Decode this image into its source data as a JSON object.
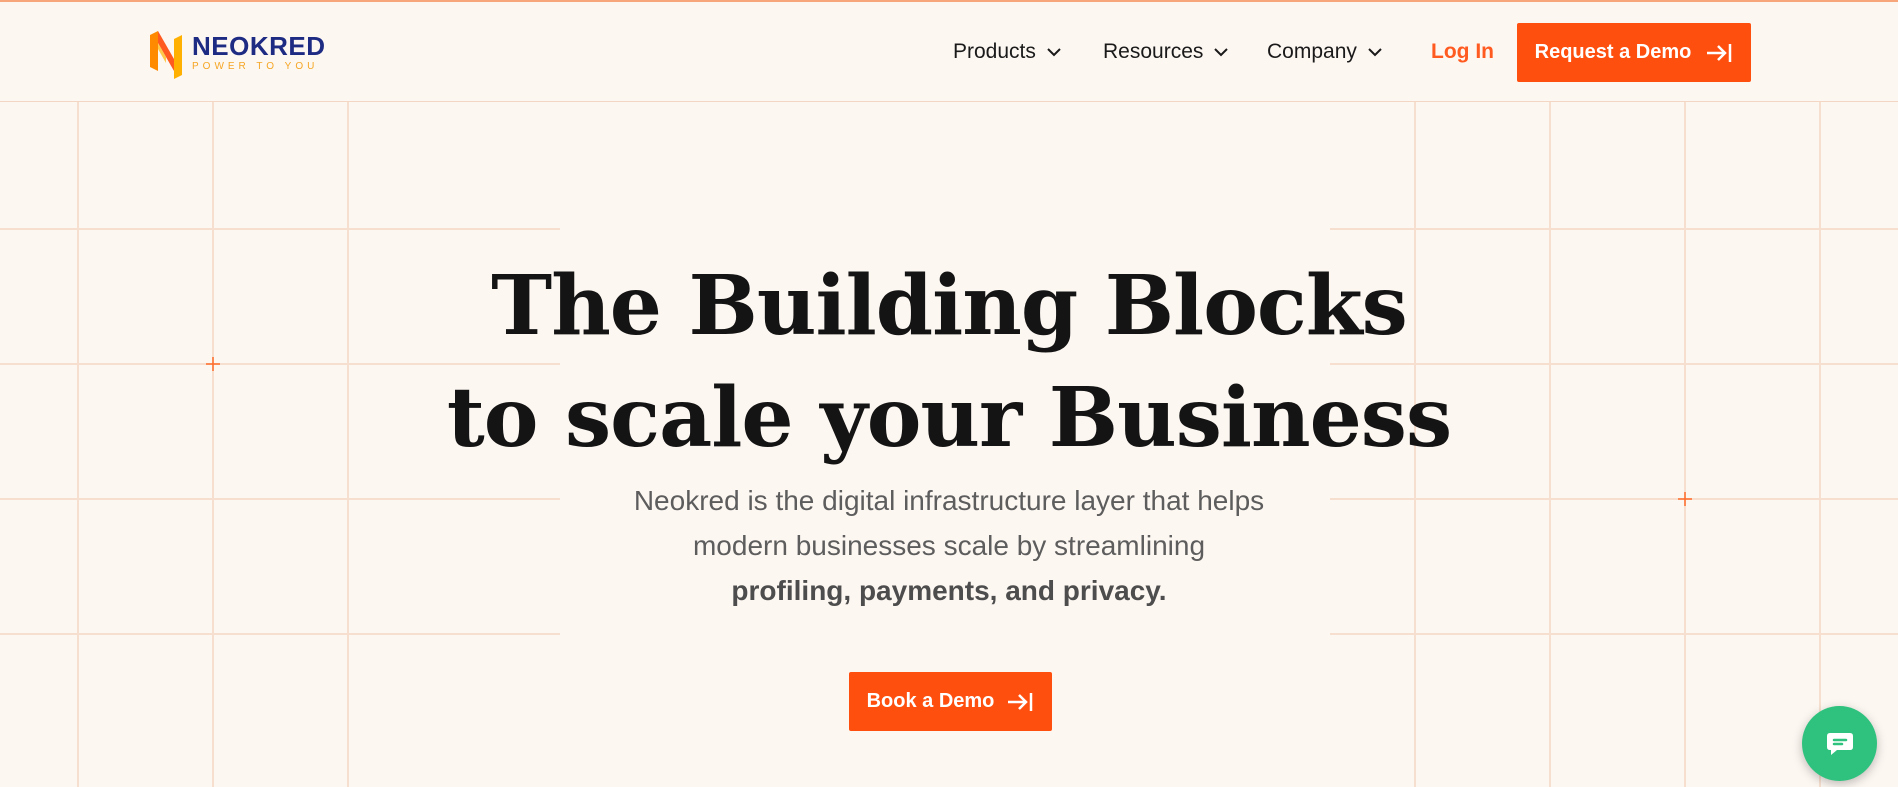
{
  "brand": {
    "name": "NEOKRED",
    "tagline": "POWER TO YOU"
  },
  "nav": {
    "items": [
      {
        "label": "Products"
      },
      {
        "label": "Resources"
      },
      {
        "label": "Company"
      }
    ],
    "login_label": "Log In",
    "cta_label": "Request a Demo"
  },
  "hero": {
    "title_line1": "The Building Blocks",
    "title_line2": "to scale your Business",
    "subtitle_line1": "Neokred is the digital infrastructure layer that helps",
    "subtitle_line2": "modern businesses scale by streamlining",
    "subtitle_bold": "profiling, payments, and privacy.",
    "cta_label": "Book a Demo"
  },
  "colors": {
    "accent": "#ff4f0f",
    "brand_blue": "#1e2b83",
    "background": "#fdf7f2",
    "chat": "#2ec27e"
  },
  "icons": {
    "nav_dropdown": "chevron-down-icon",
    "cta": "arrow-right-bar-icon",
    "chat": "chat-bubble-icon"
  }
}
